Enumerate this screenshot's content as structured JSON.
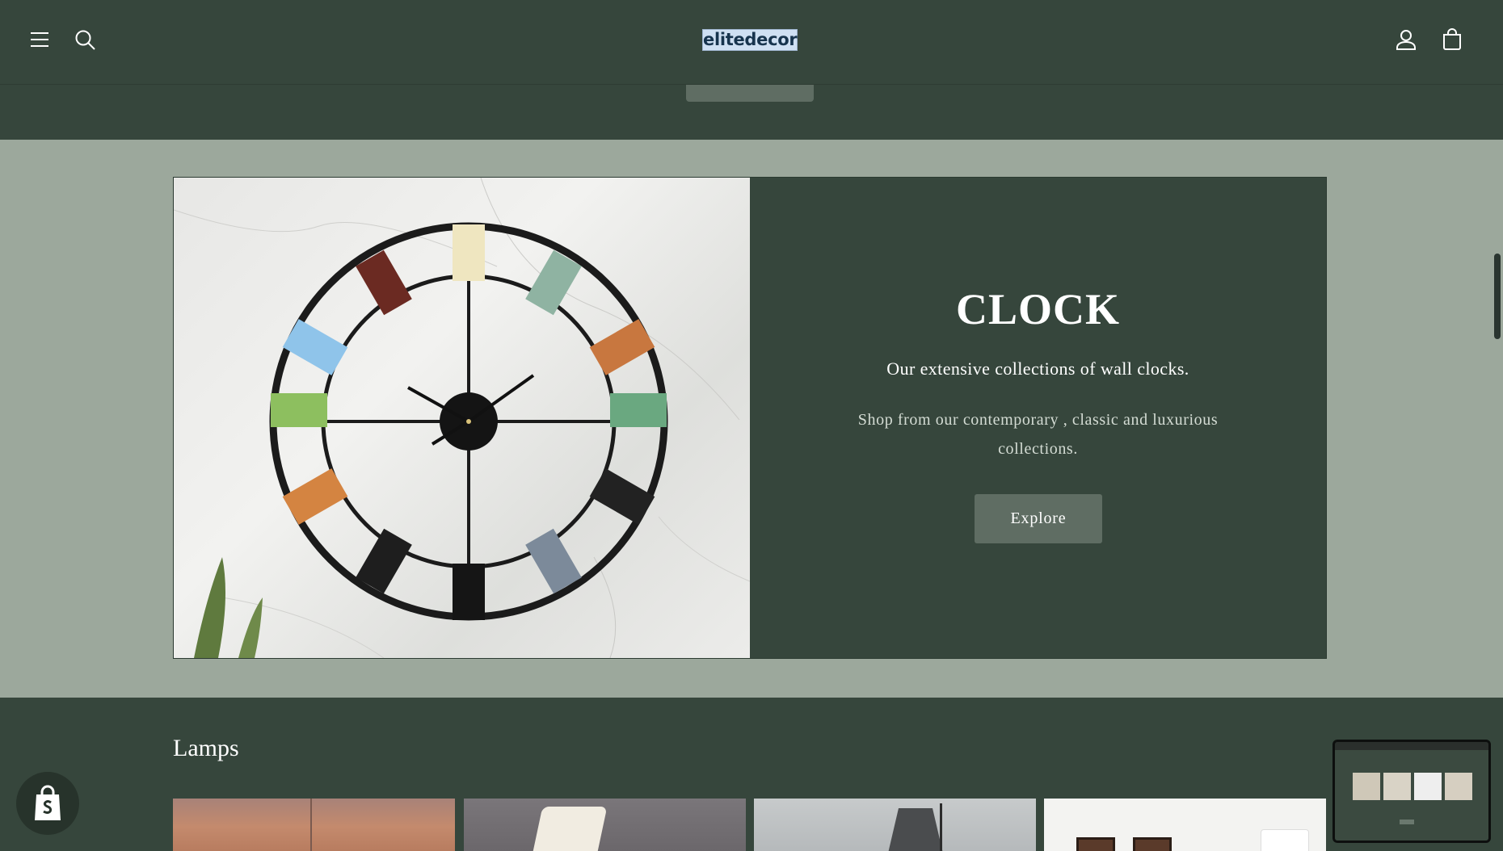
{
  "header": {
    "logo_text": "elitedecor",
    "icons": [
      "menu-icon",
      "search-icon",
      "account-icon",
      "cart-icon"
    ]
  },
  "clock_banner": {
    "title": "CLOCK",
    "subtitle": "Our extensive collections of wall clocks.",
    "description": "Shop from our contemporary , classic and luxurious collections.",
    "button_label": "Explore"
  },
  "lamps": {
    "heading": "Lamps"
  },
  "colors": {
    "background": "#36463c",
    "section_background": "#9ca89c",
    "button": "#5f6d63"
  }
}
